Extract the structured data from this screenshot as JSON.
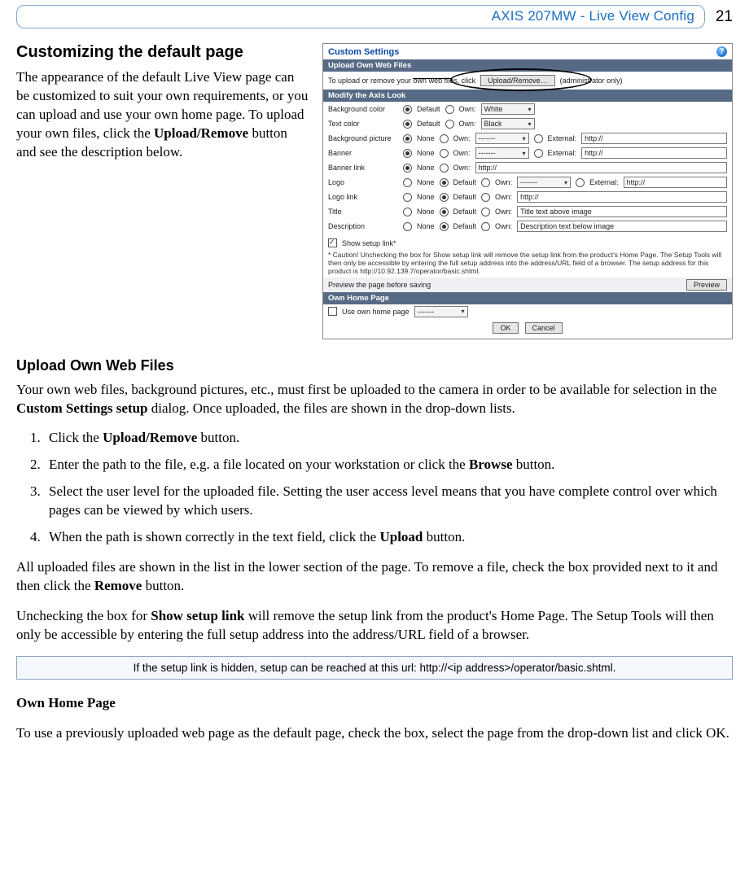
{
  "header": {
    "title": "AXIS 207MW - Live View Config",
    "page_number": "21"
  },
  "section1": {
    "heading": "Customizing the default page",
    "para_a": "The appearance of the default Live View page can be customized to suit your own requirements, or you can upload and use your own home page. To upload your own files, click the ",
    "para_b": "Upload/Remove",
    "para_c": " button and see the description below."
  },
  "screenshot": {
    "title": "Custom Settings",
    "bar_upload": "Upload Own Web Files",
    "upload_text_a": "To upload or remove your own web files, click",
    "upload_btn": "Upload/Remove…",
    "upload_text_b": "(administrator only)",
    "bar_modify": "Modify the Axis Look",
    "rows": {
      "bgcolor": "Background color",
      "textcolor": "Text color",
      "bgpic": "Background picture",
      "banner": "Banner",
      "bannerlink": "Banner link",
      "logo": "Logo",
      "logolink": "Logo link",
      "title": "Title",
      "desc": "Description"
    },
    "radio_default": "Default",
    "radio_own": "Own:",
    "radio_none": "None",
    "radio_external": "External:",
    "sel_white": "White",
    "sel_black": "Black",
    "sel_dash": "-------",
    "http": "http://",
    "title_ph": "Title text above image",
    "desc_ph": "Description text below image",
    "show_setup": "Show setup link*",
    "caution": "* Caution! Unchecking the box for Show setup link will remove the setup link from the product's Home Page. The Setup Tools will then only be accessible by entering the full setup address into the address/URL field of a browser. The setup address for this product is http://10.92.139.7/operator/basic.shtml.",
    "preview_label": "Preview the page before saving",
    "preview_btn": "Preview",
    "bar_ownhome": "Own Home Page",
    "use_own": "Use own home page",
    "ok": "OK",
    "cancel": "Cancel"
  },
  "section2": {
    "heading": "Upload Own Web Files",
    "intro_a": "Your own web files, background pictures, etc., must first be uploaded to the camera in order to be available for selection in the ",
    "intro_b": "Custom Settings setup",
    "intro_c": " dialog. Once uploaded, the files are shown in the drop-down lists.",
    "step1_a": "Click the ",
    "step1_b": "Upload/Remove",
    "step1_c": " button.",
    "step2_a": "Enter the path to the file, e.g. a file located on your workstation or click the ",
    "step2_b": "Browse",
    "step2_c": " button.",
    "step3": "Select the user level for the uploaded file. Setting the user access level means that you have complete control over which pages can be viewed by which users.",
    "step4_a": "When the path is shown correctly in the text field, click the ",
    "step4_b": "Upload",
    "step4_c": " button.",
    "after_a": "All uploaded files are shown in the list in the lower section of the page. To remove a file, check the box provided next to it and then click the ",
    "after_b": "Remove",
    "after_c": " button.",
    "uncheck_a": "Unchecking the box for ",
    "uncheck_b": "Show setup link",
    "uncheck_c": " will remove the setup link from the product's Home Page. The Setup Tools will then only be accessible by entering the full setup address into the address/URL field of a browser.",
    "note": "If the setup link is hidden, setup can be reached at this url: http://<ip address>/operator/basic.shtml."
  },
  "section3": {
    "heading": "Own Home Page",
    "para": "To use a previously uploaded web page as the default page, check the box, select the page from the drop-down list and click OK."
  }
}
